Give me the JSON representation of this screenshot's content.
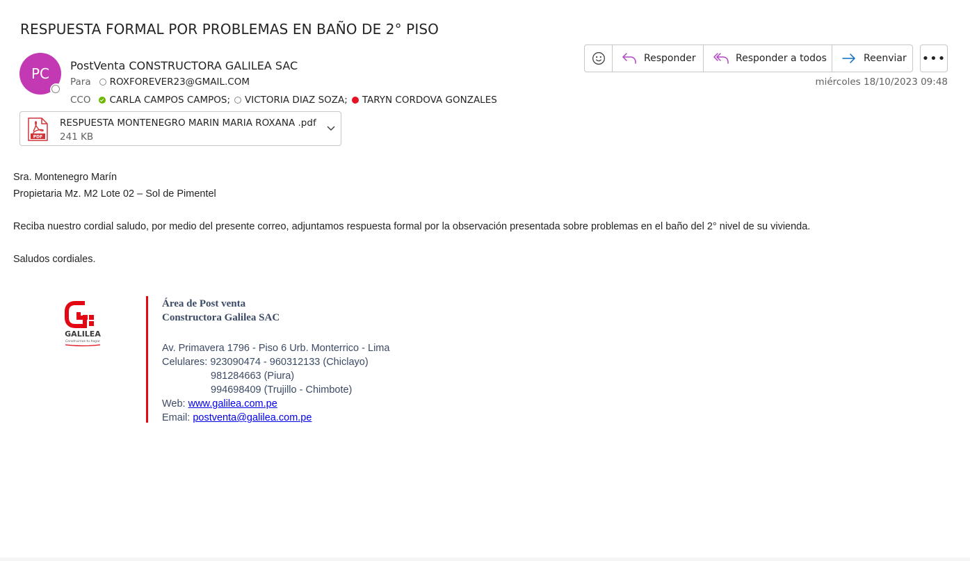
{
  "subject": "RESPUESTA FORMAL POR PROBLEMAS EN BAÑO DE 2° PISO",
  "avatar_initials": "PC",
  "avatar_color": "#c239b3",
  "sender_name": "PostVenta CONSTRUCTORA GALILEA SAC",
  "to": {
    "label": "Para",
    "recipients": [
      {
        "name": "ROXFOREVER23@GMAIL.COM",
        "presence": "offline"
      }
    ]
  },
  "cco": {
    "label": "CCO",
    "recipients": [
      {
        "name": "CARLA CAMPOS CAMPOS;",
        "presence": "available"
      },
      {
        "name": "VICTORIA DIAZ SOZA;",
        "presence": "offline"
      },
      {
        "name": "TARYN CORDOVA GONZALES",
        "presence": "busy"
      }
    ]
  },
  "attachment": {
    "name": "RESPUESTA MONTENEGRO MARIN MARIA ROXANA .pdf",
    "size": "241 KB",
    "icon": "pdf-icon"
  },
  "toolbar": {
    "emoji_icon": "smiley-icon",
    "reply_label": "Responder",
    "reply_all_label": "Responder a todos",
    "forward_label": "Reenviar",
    "more_label": "•••"
  },
  "date": "miércoles 18/10/2023 09:48",
  "body": {
    "line1": "Sra. Montenegro Marín",
    "line2": "Propietaria Mz. M2 Lote 02 – Sol de Pimentel",
    "line3": "Reciba nuestro cordial saludo, por medio del presente correo, adjuntamos respuesta formal por la observación presentada sobre problemas en el baño del 2° nivel de su vivienda.",
    "line4": "Saludos cordiales."
  },
  "signature": {
    "logo_text": "GALILEA",
    "logo_tagline": "Construimos tu hogar",
    "area": "Área de Post venta",
    "company": "Constructora Galilea SAC",
    "address": "Av. Primavera 1796 - Piso 6 Urb. Monterrico - Lima",
    "phones_label": "Celulares: ",
    "phones1": "923090474 - 960312133 (Chiclayo)",
    "phones2": "981284663 (Piura)",
    "phones3": "994698409 (Trujillo - Chimbote)",
    "web_label": "Web: ",
    "web": "www.galilea.com.pe",
    "email_label": "Email: ",
    "email": "postventa@galilea.com.pe"
  },
  "colors": {
    "accent_red": "#e30613",
    "link": "#0000ee",
    "signature_text": "#3b4a66",
    "reply_icon": "#b146c2",
    "forward_icon": "#0f6cbd"
  }
}
